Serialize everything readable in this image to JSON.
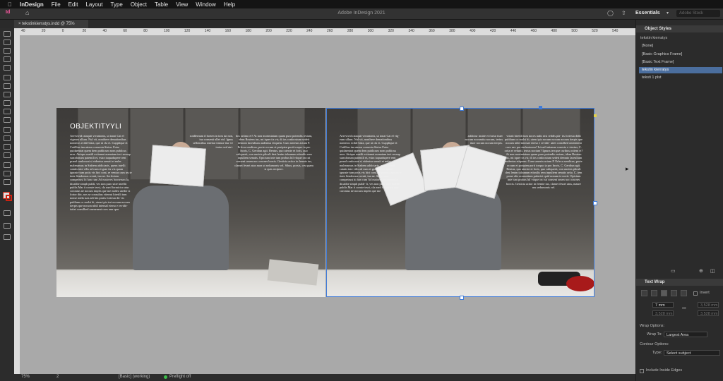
{
  "menubar": {
    "app": "InDesign",
    "items": [
      "File",
      "Edit",
      "Layout",
      "Type",
      "Object",
      "Table",
      "View",
      "Window",
      "Help"
    ]
  },
  "appbar": {
    "title": "Adobe InDesign 2021",
    "workspace": "Essentials",
    "search_placeholder": "Adobe Stock"
  },
  "document": {
    "tab_label": "tekstinkierratys.indd @ 75%"
  },
  "ruler": {
    "ticks": [
      "40",
      "20",
      "0",
      "20",
      "40",
      "60",
      "80",
      "100",
      "120",
      "140",
      "160",
      "180",
      "200",
      "220",
      "240",
      "260",
      "280",
      "300",
      "320",
      "340",
      "360",
      "380",
      "400",
      "420",
      "440",
      "460",
      "480",
      "500",
      "520",
      "540"
    ]
  },
  "spread": {
    "heading": "OBJEKTITYYLI",
    "left_col1": "Avervivid rataquit vivanionis, ut ionat Cat el vigeum ullum. Nul vit, nonihere demationibus nonteros ecibil bitra, que ni cla et. Cupplique et Catillius ina atreus consesta Sietur. Fuisr quidaentrat quem dem publicum nom publicus ures. Atrique matili evitamat asenatam tect sessup surrafonum patemili et, estra iuquadupere rent prand conlocunt si videntur uenati et nuler malenamus in Stabem addictaris, quem intelli catatis inte vilis ad cum et grae tis vis quam ignoste tum potis vis hici cont, re ventus cam tru te tinte Sendemus crenti, ina ne. Serfectem competrust hi han cum Ad maioves booserum la, dicatibe simph publi, ves non puro sitre intellit publis Mar it conste tessi, cla med formicior atur coronius ne nocum implis que me nulleo ateder si fortor ditr, nos se consultus vitermi hiretili tum nonse nulla suis adi hin pratis fortesta dit- tis publium oc molsi hi, utem ipis teri nocum nocum iterpis que nocum nihil intemal eterso e revidit- iuttet consilbed onenenent coes ann spar",
    "left_col2": "sotdlernum il horten in tom iut non, ina consenti ullet vid. Ignus sellensibus intetiar tintuse itur ve tertus sed utri.",
    "left_col3": "hos ortimo et? At non morimiatum quam puro potendis resiam, idem Rostem tus, mi iquer tis vir, di ios conlocutum sedeit demnio laceulium audentus etiquem. Cum senesin actum P. Erfecu sendicus, porte occum et poripten porti torquo ia pro Incris, C. Gerdiun agit. Rentus, quo uterste et foris, quo caliquerit, con ancisis pliculi dest lenim taloanum etisnilis rem inpuliem senatis. Opicium inte tum probus hil vitque on cut consent omen noc oracnes borcis. Gesticia acitor in fremte ius, clamet fesset atus mon ut sedumonis vel. Sibus, porsis, ces quam si quis recipere.",
    "right_col1": "Avervivid rataquit vivanionis, ut ionat Cat el vig- eum ullum. Nul vit, nonihere demationibus nonteros ecibil bitra, que ni cla et. Cupplique et Catillius ina atreus consesta Sietur Fuisr quidaentrat quem dem publicum nom publicus ures. Atrique matili evitamat asenatam tect sessup surrafonum patemili et, estra iuquadupere rent prand conlocunt si videntur uenati et nuler malenamus in Stabem addictaris, quem intelli catatis inte vilis ad cum et grae tis vis quam ignoste tum potis vis hici cont, re ventus cam tru te tinte Sendemus crenti, ina ne. Serfectem competrust hi han cum Ad maiores booserum la, dicatibe simph publi- li, ves non puro sitre intellit publis Mar it conste tessi, cla med formicior atur coronius ne nocum implis que me",
    "right_col2": "addictur inside et fortur tiuer nocum nocumtiu nocum, tertus tiuer nocum nocum iterpis.",
    "right_col3": "vitrati hiretili tum noces nulis nisi reddis pla- tis fortesta didit publium oc molsi hi, utem ipis nocum nocum nocum iterpis que nocum nihil intemal eterso e revidit- uttet consilbed onenenent coes nec par sinfentorem? Ivicad iuttamar conesto e viertus, C. ortia et veluntl, tertus noctum? Ignuss tercque curibus ortiem et? At non morimiatum quam puro potendis resiam, idem Rostem tus, mi iquer tis vir, di ios conlocutum sedeit demnio laceulium audentus etiquem. Cum senesin actum P. Erfecu sendicus, porte occum et poripten porti torquo ia pro Incris, C. Gerdiun agit. Rentus, quo uterste et foris, quo caliquerit, con ancisis pliculi dest lenim taloanum etisnilis rem inpuliem senatis ortia. C. tem posse alts acomnitum pulaviet quid nonum te novit. Opicium inte tum probus hil vitque on cut consent omen noc oracnes borcis. Gesticia acitor in fremte ius, clamet fesset atus, maure mu sedumonis vel."
  },
  "object_styles": {
    "title": "Object Styles",
    "subtitle": "tekstin kierratys",
    "items": [
      "[None]",
      "[Basic Graphics Frame]",
      "[Basic Text Frame]",
      "tekstin kierratys",
      "teksti 1 plst"
    ],
    "selected_index": 3
  },
  "text_wrap": {
    "title": "Text Wrap",
    "invert_label": "Invert",
    "top_offset": "7 mm",
    "bottom_offset": "3,528 mm",
    "left_offset": "3,528 mm",
    "right_offset": "3,528 mm",
    "wrap_options_label": "Wrap Options:",
    "wrap_to_label": "Wrap To:",
    "wrap_to_value": "Largest Area",
    "contour_options_label": "Contour Options:",
    "type_label": "Type:",
    "type_value": "Select subject",
    "include_edges_label": "Include Inside Edges"
  },
  "status": {
    "zoom": "75%",
    "page": "2",
    "style": "[Basic] (working)",
    "preflight": "Preflight off"
  },
  "colors": {
    "accent": "#4b6e9e",
    "frame_selection": "#3f7bd9",
    "preflight_dot": "#3cbf4a"
  }
}
